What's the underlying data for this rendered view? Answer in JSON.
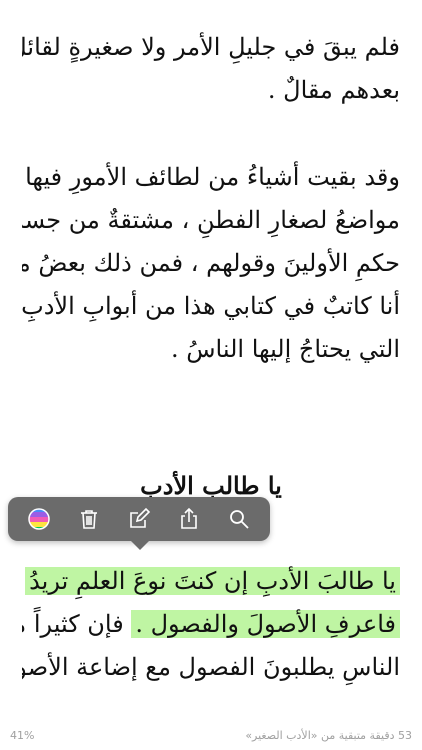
{
  "book": {
    "paragraphs": [
      {
        "lines": [
          "فلم يبقَ في جليلِ الأمر ولا صغيرةٍ لقائلٍ",
          "بعدهم مقالٌ ."
        ]
      },
      {
        "lines": [
          "وقد بقيت أشياءُ من لطائف الأمورِ فيها",
          "مواضعُ لصغارِ الفطنِ ، مشتقةٌ من جسام",
          "حكمِ الأولينَ وقولهم ، فمن ذلك بعضُ ما",
          "أنا كاتبٌ في كتابي هذا من أبوابِ الأدبِ",
          "التي يحتاجُ إليها الناسُ ."
        ]
      }
    ],
    "heading": "يا طالب الأدب",
    "paragraph3": {
      "highlight_line1": "يا طالبَ الأدبِ إن كنتَ نوعَ العلمِ تريدُ",
      "highlight_line2": "فاعرفِ الأصولَ والفصول .",
      "line2_rest": "فإن كثيراً من",
      "line3": "الناسِ يطلبونَ الفصول مع إضاعة الأصول"
    }
  },
  "toolbar": {
    "icons": [
      "color-palette-icon",
      "trash-icon",
      "edit-note-icon",
      "share-icon",
      "search-icon"
    ],
    "highlight_color": "#bff5a3",
    "background_color": "#6b6b6b"
  },
  "status": {
    "percent": "41%",
    "pages_left": "53 دقيقة متبقية من «الأدب الصغير»"
  }
}
